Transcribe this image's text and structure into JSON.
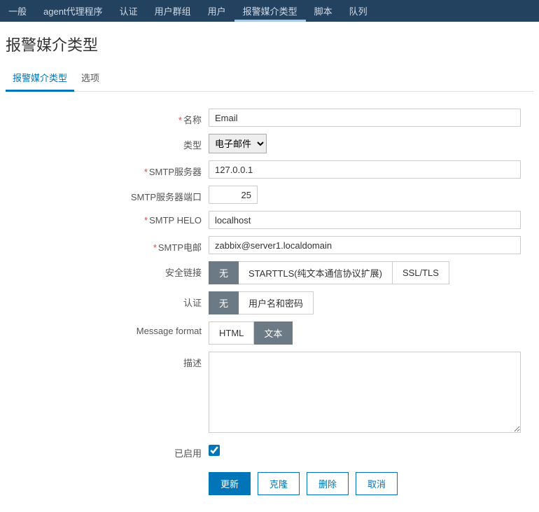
{
  "top_nav": {
    "items": [
      {
        "label": "一般"
      },
      {
        "label": "agent代理程序"
      },
      {
        "label": "认证"
      },
      {
        "label": "用户群组"
      },
      {
        "label": "用户"
      },
      {
        "label": "报警媒介类型",
        "active": true
      },
      {
        "label": "脚本"
      },
      {
        "label": "队列"
      }
    ]
  },
  "page_title": "报警媒介类型",
  "sub_tabs": {
    "items": [
      {
        "label": "报警媒介类型",
        "active": true
      },
      {
        "label": "选项"
      }
    ]
  },
  "form": {
    "name": {
      "label": "名称",
      "value": "Email",
      "required": true
    },
    "type": {
      "label": "类型",
      "selected": "电子邮件",
      "options": [
        "电子邮件"
      ]
    },
    "smtp_server": {
      "label": "SMTP服务器",
      "value": "127.0.0.1",
      "required": true
    },
    "smtp_port": {
      "label": "SMTP服务器端口",
      "value": "25"
    },
    "smtp_helo": {
      "label": "SMTP HELO",
      "value": "localhost",
      "required": true
    },
    "smtp_email": {
      "label": "SMTP电邮",
      "value": "zabbix@server1.localdomain",
      "required": true
    },
    "security": {
      "label": "安全链接",
      "options": [
        "无",
        "STARTTLS(纯文本通信协议扩展)",
        "SSL/TLS"
      ],
      "selected_index": 0
    },
    "auth": {
      "label": "认证",
      "options": [
        "无",
        "用户名和密码"
      ],
      "selected_index": 0
    },
    "message_format": {
      "label": "Message format",
      "options": [
        "HTML",
        "文本"
      ],
      "selected_index": 1
    },
    "description": {
      "label": "描述",
      "value": ""
    },
    "enabled": {
      "label": "已启用",
      "checked": true
    }
  },
  "actions": {
    "update": "更新",
    "clone": "克隆",
    "delete": "删除",
    "cancel": "取消"
  }
}
